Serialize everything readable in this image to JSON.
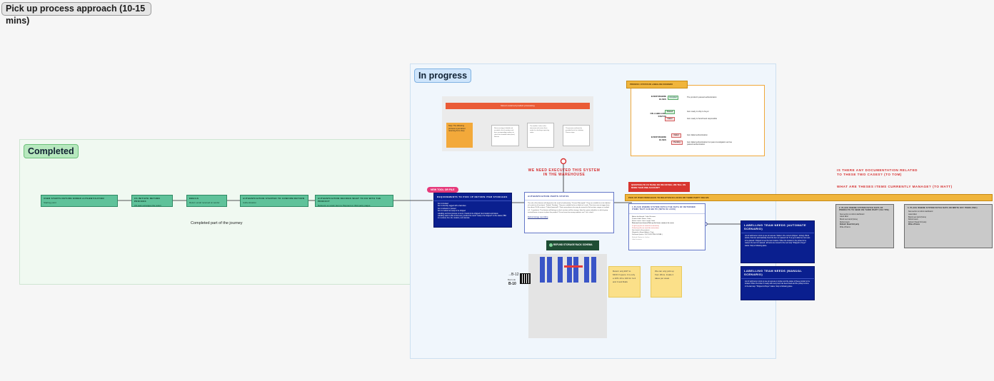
{
  "board_title": "Pick up process approach (10-15 mins)",
  "sections": {
    "completed": {
      "label": "Completed",
      "caption": "Completed part of the journey"
    },
    "in_progress": {
      "label": "In progress"
    }
  },
  "completed_steps": [
    {
      "title": "USER STARTS RETURN ORDER AUTHENTICATION",
      "body": "Starting point"
    },
    {
      "title": "CS INITIATE RETURN PROCESS",
      "body": "CS team arranges the return"
    },
    {
      "title": "EMAILS",
      "body": "Return email received at vendor"
    },
    {
      "title": "AUTHENTICATION STARTED TO CONFIRM RETURN",
      "body": "Authentication"
    },
    {
      "title": "AUTHENTICATION DECIDES WHAT TO DO WITH THE PRODUCT",
      "body": "Refund it or return item to Payment or third party pages"
    }
  ],
  "flow_mock": {
    "banner": "Return returned product processing",
    "yellow_box": "Step: The following process is just about returning from shop",
    "steps": [
      "Return arriving is labeled and recorded a list of numbers and their corresponding numbers to check the recorded codes (item) Returns",
      "The installer / takes to the storeroom and arrives them under the checkings expecting codes",
      "Authentication checks for Authentication but is is not possible for anything",
      "The process confirmed as provided that it the Labeling Process steps"
    ]
  },
  "status_panel": {
    "title": "PROCESS 1 STATUS ON LABELLING SCENARIO",
    "groups": [
      "EVERYWHERE ELSES",
      "ON LABELLING STATUS",
      "EVERYWHERE ELSES"
    ],
    "badges": [
      "Accepted",
      "Passed",
      "Failed",
      "Failed",
      "Pending"
    ],
    "notes": [
      "The product's passed authentication",
      "Item ready to ship to buyer",
      "Item ready to Send back responsible",
      "Item failed authentication",
      "Item failed authentication but pass investigation as has passed authentication"
    ]
  },
  "notes": {
    "warehouse": "WE NEED EXECUTED THIS SYSTEM IN THE WAREHOUSE",
    "documentation_q": "IS THERE ANY DOCUMENTATION RELATED TO THESE TWO CASES? (TO TOM)",
    "manage_q": "WHAT ARE THESES ITEMS CURRENTLY MANAGE? (TO MATT)"
  },
  "red_question": "QUESTION (TO CS TEAM): DO WE OR WILL WE TELL ON MORE THAN ONE ACCOUNT?",
  "pill": "NEW TOOL OR FILE",
  "requirements_card": {
    "title": "REQUIREMENTS TO PICK UP RETURN ITEM STORAGES",
    "items": [
      "Item is located",
      "Item is identify, tagged with a barcodes",
      "Item is labeled or passed",
      "Item is marked as ready to be shipped",
      "Labelling and how process to return / hands to be shipped: Item location and status",
      "Labelling team is able to find every product the result \"ready to be shipped\" on the status (TBD in a review): box, bin, location, cell, barcode"
    ]
  },
  "auth_card": {
    "title": "AUTHENTICATION PARTS STATUS",
    "body": "The role of the division will depend on the result of authenticity. \"Passed / Accepted\": They are suitable for to be labeled at Locale (in all sections). \"Failed / Pending\": They are suitable for be re-label on Locale. Their time now to trigger from the others 25-30 sections. \"Failed (rejected)\": Those procedures also may be moved to 3rd sections ranges or verified (+3 - 5 products). The division will belong in which sections will be storage. How the system identifies in which group section/frame or space to place the product? Do we know how many products are? Let's check!",
    "link": "Refund storage new sitting"
  },
  "storage_chip": "REFUND STORAGE RACK SCHEMA",
  "qr_labels": {
    "line1": "→B-12",
    "line2": "Barcode",
    "line3": "B-10"
  },
  "stickies": [
    "Return only EST to MOO if opens. It is only a 10% 10 to 100 for 3+3 and 3 and Rails",
    "We can only pick up from 20ms. Inside it takes per week"
  ],
  "orange_banner": "PICK UP ITEM FROM BACK TO RELETIVE IN LOCKS OR THIRD PARTY DELIVE",
  "pickup_card": {
    "title": "1.PLACE WHERE SYSTEM FETCH THE DATA OF RETURNED ITEMS THAT CAN BE PU (WITH IN LOCK)",
    "items": [
      "Admin dashboard / Label Scanner",
      "Product label: Name, Order",
      "Return status: Items ready / label",
      "Returned sent items (Pick up list items ready to be sent)",
      "To pick up (Do we need the instruction)",
      "Picked up (Do we need the instruction)",
      "Sent (sent to the partner)",
      "Shipped to Buyer (Admin / Tag)",
      "Delivered (status - NOT EXISTING DETAIL)",
      "Refund: Return to Locker",
      "Label scanner"
    ]
  },
  "labelling_auto": {
    "title": "LABELLING TEAM NEEDS (AUTOMATE SCENARIO)",
    "body": "List of sold items in lock up we can access. Status in the current (shipper / lockup). Block stocks, that can automatically check the item on 'passed' all. If we get a label we can scan to be passed / shipped to see the item location. When the location is the picked to be ready to be sent on 'passed', all items are moved to the next step \"Shipped to buyer\" status. Stop to following place."
  },
  "labelling_manual": {
    "title": "LABELLING TEAM NEEDS (MANUAL SCENARIO)",
    "body": "List of sold items in lock up we can access on locker and the status of these product to be located. When the locker is ready with every item has been listed and the pickup is done in the last step: \"Shipped to Buyer\" status. Stop to following place."
  },
  "grey_cards": [
    {
      "title": "2. PLACE WHERE SYSTEM FETCH DATA OF PRODUCTS TO SEND ON THIRD PARTY (VIA TPE)",
      "items": [
        "New section on Admin dashboard",
        "Latest label",
        "Brand new stock (future)",
        "Refund users",
        "Refund / Resell 3rd party",
        "Write-off items"
      ]
    },
    {
      "title": "3. PLACE WHERE SYSTEM FETCH DATA ON WRITE OFF ITEMS (TBC)",
      "items": [
        "New section on Admin dashboard",
        "Latest label",
        "Brand new stock (future)",
        "Refund users",
        "Refund / Resell 3rd party",
        "Write-off items"
      ]
    }
  ],
  "colors": {
    "green_step": "#5fc29a",
    "blue_card": "#0a1f8f",
    "orange": "#f0b53c",
    "red": "#d62f2f"
  }
}
